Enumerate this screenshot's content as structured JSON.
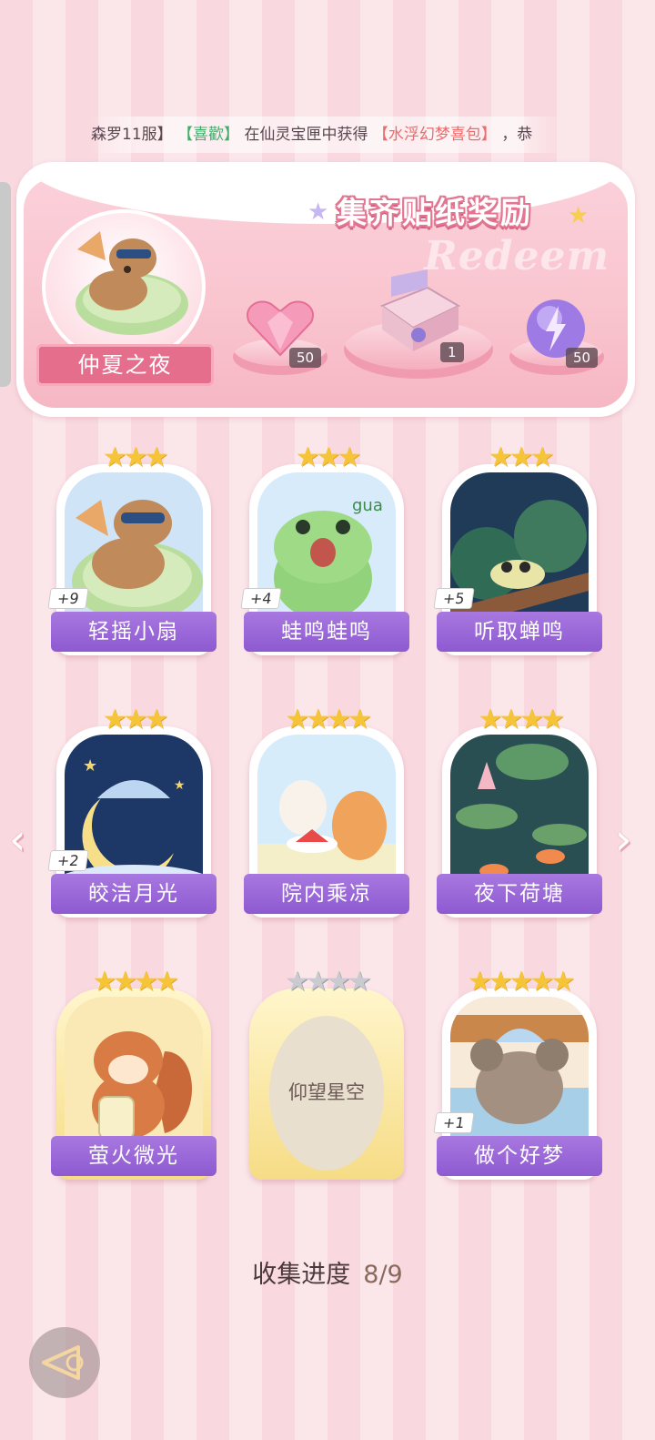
{
  "ticker": {
    "segment_1": "森罗11服】",
    "segment_2": "【喜歡】",
    "segment_3": "在仙灵宝匣中获得",
    "segment_4": "【水浮幻梦喜包】",
    "segment_5": "，恭"
  },
  "reward_panel": {
    "title": "集齐贴纸奖励",
    "watermark": "Redeem",
    "badge_name": "仲夏之夜",
    "rewards": [
      {
        "icon": "pink-heart-gem-icon",
        "count": "50"
      },
      {
        "icon": "gift-box-icon",
        "count": "1"
      },
      {
        "icon": "purple-lightning-orb-icon",
        "count": "50"
      }
    ]
  },
  "stickers": [
    {
      "name": "轻摇小扇",
      "stars": 3,
      "bonus": "+9",
      "icon": "capybara-fan-icon"
    },
    {
      "name": "蛙鸣蛙鸣",
      "stars": 3,
      "bonus": "+4",
      "icon": "frog-icon"
    },
    {
      "name": "听取蝉鸣",
      "stars": 3,
      "bonus": "+5",
      "icon": "cicada-icon"
    },
    {
      "name": "皎洁月光",
      "stars": 3,
      "bonus": "+2",
      "icon": "moon-icon"
    },
    {
      "name": "院内乘凉",
      "stars": 4,
      "bonus": "",
      "icon": "cats-watermelon-icon"
    },
    {
      "name": "夜下荷塘",
      "stars": 4,
      "bonus": "",
      "icon": "lotus-pond-icon"
    },
    {
      "name": "萤火微光",
      "stars": 4,
      "bonus": "",
      "icon": "squirrel-firefly-icon"
    },
    {
      "name": "仰望星空",
      "stars": 4,
      "bonus": "",
      "icon": "locked-sticker-icon",
      "locked": true
    },
    {
      "name": "做个好梦",
      "stars": 5,
      "bonus": "+1",
      "icon": "koala-sleep-icon"
    }
  ],
  "progress": {
    "label": "收集进度",
    "value": "8/9"
  },
  "colors": {
    "label_purple": "#8d5ad0",
    "pink_accent": "#e56e8c",
    "star_gold": "#f6c537",
    "star_grey": "#c9cbd1"
  }
}
